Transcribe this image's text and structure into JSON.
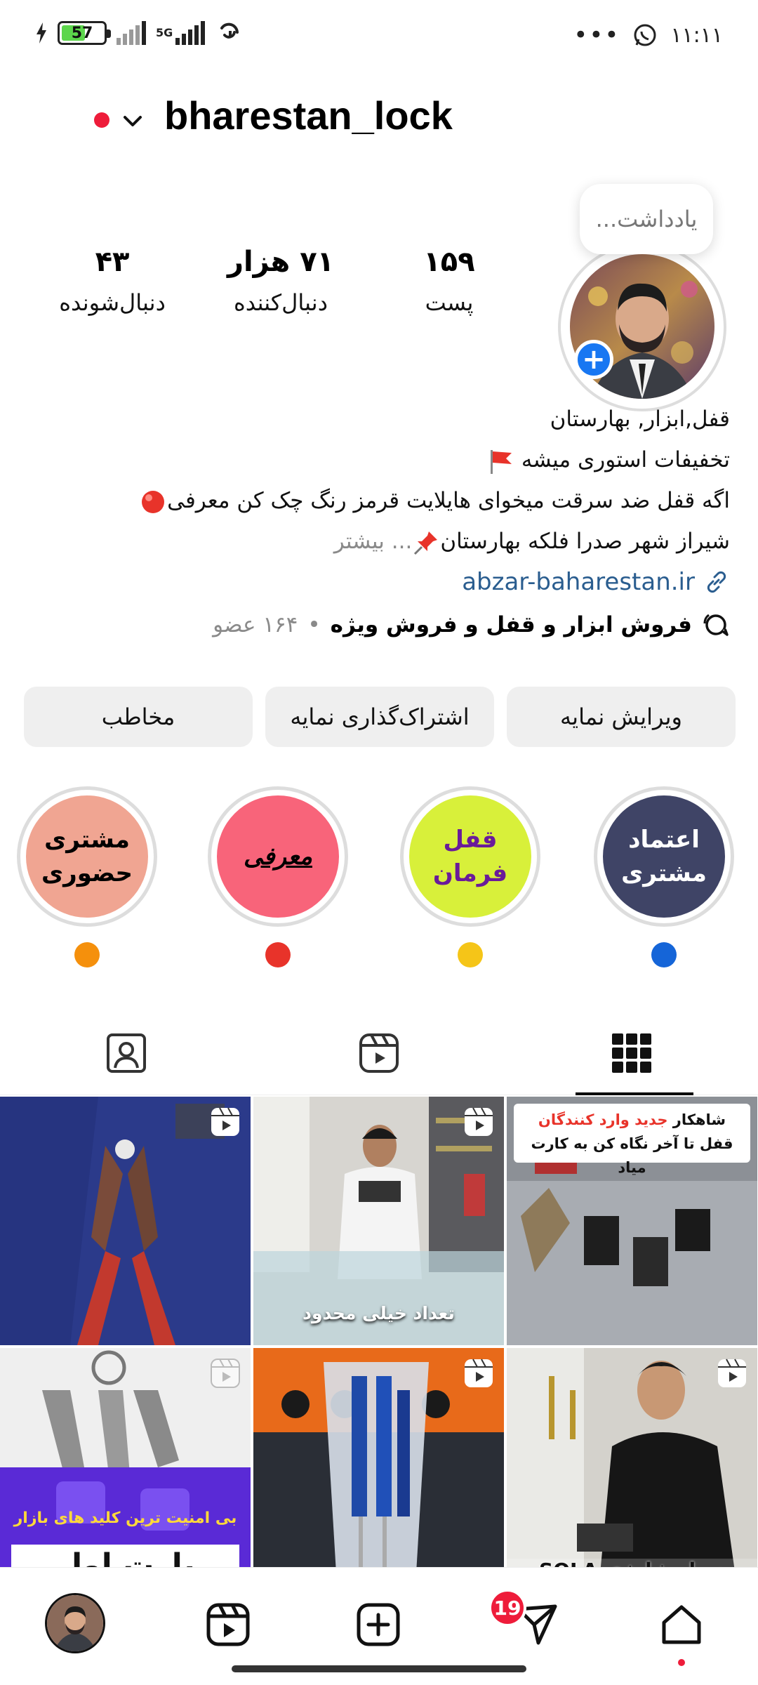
{
  "status_bar": {
    "battery": "57",
    "battery_percent": 57,
    "network": "5G",
    "time": "۱۱:۱۱",
    "more": "•••"
  },
  "header": {
    "username": "bharestan_lock"
  },
  "profile": {
    "note_placeholder": "یادداشت...",
    "stats": [
      {
        "value": "۱۵۹",
        "label": "پست"
      },
      {
        "value": "۷۱ هزار",
        "label": "دنبال‌کننده"
      },
      {
        "value": "۴۳",
        "label": "دنبال‌شونده"
      }
    ],
    "bio": {
      "name": "قفل,ابزار, بهارستان",
      "line2": "تخفیفات استوری میشه",
      "line3": "اگه قفل ضد سرقت میخوای هایلایت قرمز رنگ چک کن معرفی",
      "line4": "شیراز شهر صدرا فلکه بهارستان",
      "more": "... بیشتر",
      "link": "abzar-baharestan.ir"
    },
    "channel": {
      "name": "فروش ابزار و قفل و فروش ویژه",
      "members": "۱۶۴ عضو"
    }
  },
  "buttons": {
    "edit": "ویرایش نمایه",
    "share": "اشتراک‌گذاری نمایه",
    "contact": "مخاطب"
  },
  "highlights": [
    {
      "title": "اعتماد\nمشتری",
      "bg": "#3f4466",
      "fg": "#ffffff",
      "dot": "#1565d8"
    },
    {
      "title": "قفل\nفرمان",
      "bg": "#d8f03a",
      "fg": "#6a1b9a",
      "dot": "#f5c518"
    },
    {
      "title": "معرفی",
      "bg": "#f8647a",
      "fg": "#000000",
      "dot": "#e8332a"
    },
    {
      "title": "مشتری\nحضوری",
      "bg": "#f0a592",
      "fg": "#000000",
      "dot": "#f5900c"
    }
  ],
  "grid": {
    "posts": [
      {
        "caption": ""
      },
      {
        "caption": "تعداد خیلی محدود"
      },
      {
        "caption": "شاهکار جدید وارد کنندگان قفل تا آخر نگاه کن به کارت میاد",
        "highlight": "جدید وارد کنندگان"
      },
      {
        "caption": "بی امنیت ترین کلید های بازار",
        "caption2": "پارت اول"
      },
      {
        "caption": ""
      },
      {
        "caption": "دریل شارژی SOLA"
      }
    ]
  },
  "bottom_nav": {
    "badge": "19"
  },
  "colors": {
    "link": "#2a5d8f",
    "accent_blue": "#1877f2",
    "badge_red": "#ee1c3a"
  }
}
